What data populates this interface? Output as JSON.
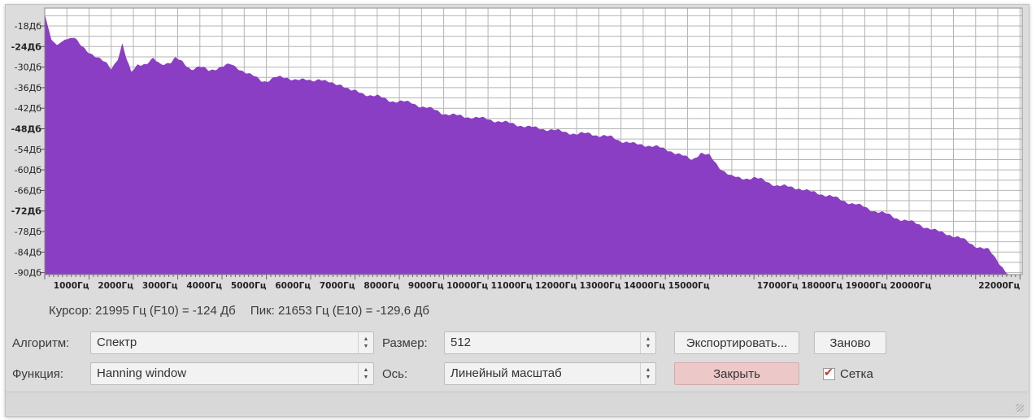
{
  "spectrum": {
    "fill_color": "#8a3ec4",
    "db_labels": [
      "-18Дб",
      "-24Дб",
      "-30Дб",
      "-36Дб",
      "-42Дб",
      "-48Дб",
      "-54Дб",
      "-60Дб",
      "-66Дб",
      "-72Дб",
      "-78Дб",
      "-84Дб",
      "-90Дб"
    ],
    "freq_labels": [
      "1000Гц",
      "2000Гц",
      "3000Гц",
      "4000Гц",
      "5000Гц",
      "6000Гц",
      "7000Гц",
      "8000Гц",
      "9000Гц",
      "10000Гц",
      "11000Гц",
      "12000Гц",
      "13000Гц",
      "14000Гц",
      "15000Гц",
      "17000Гц",
      "18000Гц",
      "19000Гц",
      "20000Гц",
      "22000Гц"
    ],
    "freq_label_hz": [
      1000,
      2000,
      3000,
      4000,
      5000,
      6000,
      7000,
      8000,
      9000,
      10000,
      11000,
      12000,
      13000,
      14000,
      15000,
      17000,
      18000,
      19000,
      20000,
      22000
    ]
  },
  "status": {
    "cursor": "Курсор: 21995 Гц (F10) = -124 Дб",
    "peak": "Пик: 21653 Гц (E10) = -129,6 Дб"
  },
  "controls": {
    "algorithm_label": "Алгоритм:",
    "algorithm_value": "Спектр",
    "function_label": "Функция:",
    "function_value": "Hanning window",
    "size_label": "Размер:",
    "size_value": "512",
    "axis_label": "Ось:",
    "axis_value": "Линейный масштаб",
    "export_button": "Экспортировать...",
    "replot_button": "Заново",
    "close_button": "Закрыть",
    "grid_checkbox": "Сетка"
  }
}
